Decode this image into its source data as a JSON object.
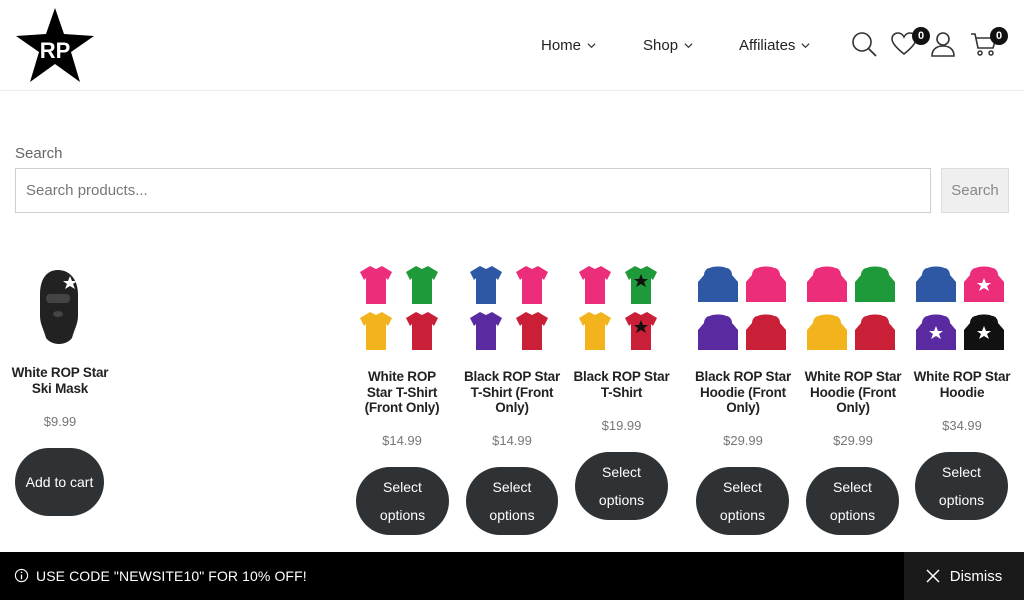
{
  "nav": {
    "home": "Home",
    "shop": "Shop",
    "affiliates": "Affiliates"
  },
  "header": {
    "wishlist_count": "0",
    "cart_count": "0",
    "icons": [
      "search-icon",
      "heart-icon",
      "user-icon",
      "cart-icon"
    ]
  },
  "search": {
    "label": "Search",
    "placeholder": "Search products...",
    "button": "Search"
  },
  "products": [
    {
      "title": "White ROP Star Ski Mask",
      "price": "$9.99",
      "button": "Add to cart"
    },
    {
      "title": "White ROP Star T-Shirt (Front Only)",
      "price": "$14.99",
      "button": "Select options"
    },
    {
      "title": "Black ROP Star T-Shirt (Front Only)",
      "price": "$14.99",
      "button": "Select options"
    },
    {
      "title": "Black ROP Star T-Shirt",
      "price": "$19.99",
      "button": "Select options"
    },
    {
      "title": "Black ROP Star Hoodie (Front Only)",
      "price": "$29.99",
      "button": "Select options"
    },
    {
      "title": "White ROP Star Hoodie (Front Only)",
      "price": "$29.99",
      "button": "Select options"
    },
    {
      "title": "White ROP Star Hoodie",
      "price": "$34.99",
      "button": "Select options"
    }
  ],
  "colors": {
    "pink": "#ec2d7a",
    "green": "#1f9a3a",
    "yellow": "#f2b31c",
    "red": "#c91f37",
    "blue": "#2f58a4",
    "purple": "#5a2aa0",
    "black": "#111111",
    "button": "#2e3234"
  },
  "banner": {
    "text": "USE CODE \"NEWSITE10\" FOR 10% OFF!",
    "dismiss": "Dismiss"
  }
}
